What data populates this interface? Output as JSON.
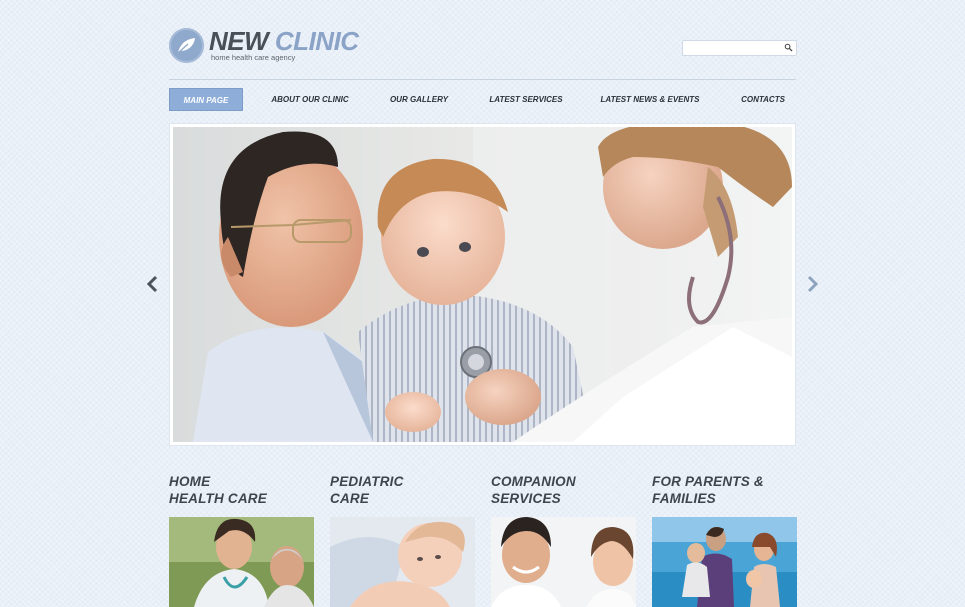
{
  "brand": {
    "name_part1": "NEW",
    "name_part2": "CLINIC",
    "tagline": "home health care agency",
    "logo_icon": "leaf-icon",
    "accent": "#8eadd8"
  },
  "search": {
    "placeholder": "",
    "icon": "search-icon"
  },
  "nav": {
    "items": [
      {
        "label": "MAIN PAGE",
        "active": true
      },
      {
        "label": "ABOUT OUR CLINIC"
      },
      {
        "label": "OUR GALLERY"
      },
      {
        "label": "LATEST SERVICES"
      },
      {
        "label": "LATEST NEWS & EVENTS"
      },
      {
        "label": "CONTACTS"
      }
    ]
  },
  "slider": {
    "prev_icon": "chevron-left-icon",
    "next_icon": "chevron-right-icon"
  },
  "features": [
    {
      "line1": "HOME",
      "line2": "HEALTH CARE"
    },
    {
      "line1": "PEDIATRIC",
      "line2": "CARE"
    },
    {
      "line1": "COMPANION",
      "line2": "SERVICES"
    },
    {
      "line1": "FOR PARENTS &",
      "line2": "FAMILIES"
    }
  ]
}
